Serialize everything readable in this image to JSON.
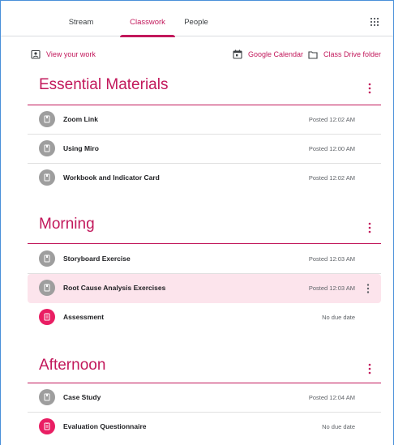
{
  "nav": {
    "tabs": [
      {
        "label": "Stream",
        "active": false
      },
      {
        "label": "Classwork",
        "active": true
      },
      {
        "label": "People",
        "active": false
      }
    ],
    "apps_icon": "apps-grid-icon"
  },
  "actions": {
    "view_work": {
      "label": "View your work",
      "icon": "assignment-ind-icon"
    },
    "calendar": {
      "label": "Google Calendar",
      "icon": "calendar-icon"
    },
    "drive": {
      "label": "Class Drive folder",
      "icon": "folder-icon"
    }
  },
  "colors": {
    "accent": "#c2185b",
    "assignment": "#e91e63",
    "material": "#9e9e9e",
    "highlight": "#fce4ec"
  },
  "sections": [
    {
      "title": "Essential Materials",
      "items": [
        {
          "title": "Zoom Link",
          "meta": "Posted 12:02 AM",
          "kind": "material"
        },
        {
          "title": "Using Miro",
          "meta": "Posted 12:00 AM",
          "kind": "material"
        },
        {
          "title": "Workbook and Indicator Card",
          "meta": "Posted 12:02 AM",
          "kind": "material"
        }
      ]
    },
    {
      "title": "Morning",
      "items": [
        {
          "title": "Storyboard Exercise",
          "meta": "Posted 12:03 AM",
          "kind": "material"
        },
        {
          "title": "Root Cause Analysis Exercises",
          "meta": "Posted 12:03 AM",
          "kind": "material",
          "hovered": true
        },
        {
          "title": "Assessment",
          "meta": "No due date",
          "kind": "assignment"
        }
      ]
    },
    {
      "title": "Afternoon",
      "items": [
        {
          "title": "Case Study",
          "meta": "Posted 12:04 AM",
          "kind": "material"
        },
        {
          "title": "Evaluation Questionnaire",
          "meta": "No due date",
          "kind": "assignment"
        }
      ]
    }
  ]
}
